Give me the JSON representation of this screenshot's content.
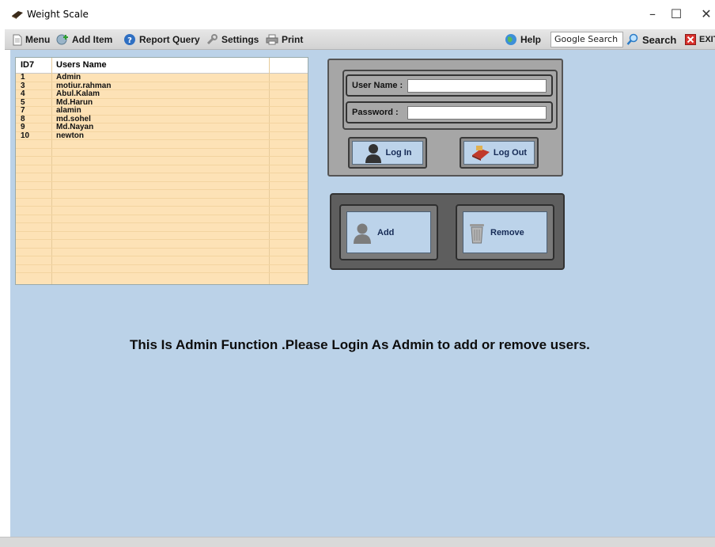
{
  "window": {
    "title": "Weight Scale",
    "controls": {
      "minimize": "–",
      "maximize": "☐",
      "close": "✕"
    }
  },
  "toolbar": {
    "items": [
      {
        "label": "Menu",
        "icon": "document-icon"
      },
      {
        "label": "Add Item",
        "icon": "add-item-icon"
      },
      {
        "label": "Report Query",
        "icon": "help-circle-icon"
      },
      {
        "label": "Settings",
        "icon": "wrench-icon"
      },
      {
        "label": "Print",
        "icon": "printer-icon"
      }
    ],
    "help_label": "Help",
    "google_search_value": "Google Search",
    "search_label": "Search",
    "exit_label": "EXIT"
  },
  "users_grid": {
    "columns": [
      "ID7",
      "Users Name"
    ],
    "rows": [
      {
        "id": "1",
        "name": "Admin"
      },
      {
        "id": "3",
        "name": "motiur.rahman"
      },
      {
        "id": "4",
        "name": "Abul.Kalam"
      },
      {
        "id": "5",
        "name": "Md.Harun"
      },
      {
        "id": "7",
        "name": "alamin"
      },
      {
        "id": "8",
        "name": "md.sohel"
      },
      {
        "id": "9",
        "name": "Md.Nayan"
      },
      {
        "id": "10",
        "name": "newton"
      }
    ]
  },
  "login": {
    "username_label": "User Name :",
    "username_value": "",
    "password_label": "Password :",
    "password_value": "",
    "login_label": "Log In",
    "logout_label": "Log Out"
  },
  "admin": {
    "add_label": "Add",
    "remove_label": "Remove"
  },
  "notice": "This Is Admin Function .Please Login As Admin to add or remove users.",
  "colors": {
    "form_background": "#bbd2e8",
    "grid_background": "#fde2b6",
    "button_face": "#bcd3ea",
    "panel_gray": "#a6a6a6"
  }
}
